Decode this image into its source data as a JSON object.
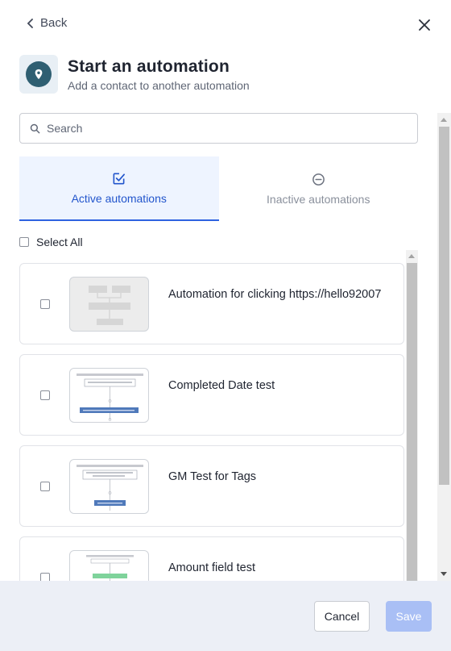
{
  "header": {
    "back_label": "Back",
    "title": "Start an automation",
    "subtitle": "Add a contact to another automation"
  },
  "search": {
    "placeholder": "Search",
    "value": ""
  },
  "tabs": [
    {
      "label": "Active automations",
      "state": "active"
    },
    {
      "label": "Inactive automations",
      "state": "inactive"
    }
  ],
  "select_all_label": "Select All",
  "automations": [
    {
      "name": "Automation for clicking https://hello92007",
      "preview": "placeholder"
    },
    {
      "name": "Completed Date test",
      "preview": "flow"
    },
    {
      "name": "GM Test for Tags",
      "preview": "flow"
    },
    {
      "name": "Amount field test",
      "preview": "flow-green"
    }
  ],
  "footer": {
    "cancel_label": "Cancel",
    "save_label": "Save"
  },
  "colors": {
    "accent": "#2f63e0",
    "active_tab_bg": "#eef4ff",
    "save_disabled": "#a9bff5",
    "footer_bg": "#eceff6",
    "icon_bg": "#2f5f72"
  },
  "icons": {
    "back": "chevron-left-icon",
    "close": "close-icon",
    "title": "map-pin-icon",
    "search": "search-icon",
    "active_tab": "checkbox-check-icon",
    "inactive_tab": "minus-circle-icon"
  }
}
